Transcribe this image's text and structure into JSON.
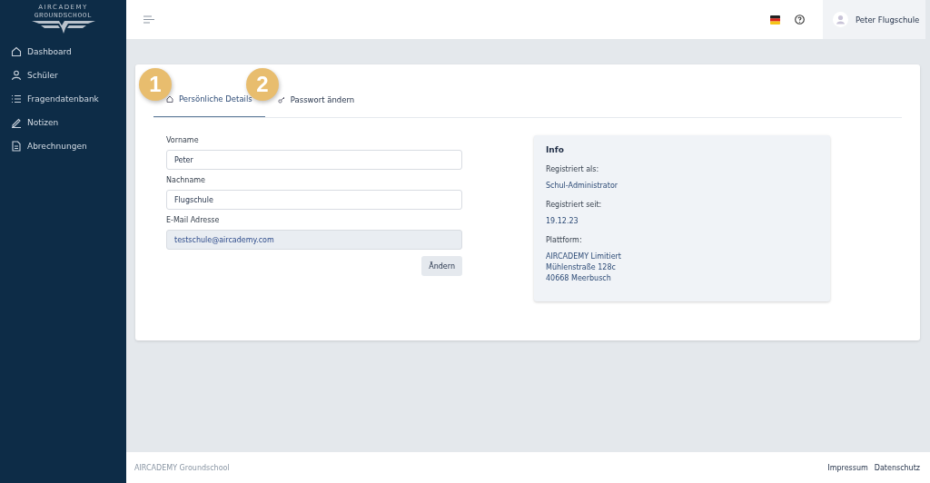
{
  "brand": {
    "line1": "AIRCADEMY",
    "line2": "GROUNDSCHOOL"
  },
  "sidebar": {
    "items": [
      {
        "label": "Dashboard",
        "kind": "home",
        "selected": false
      },
      {
        "label": "Schüler",
        "kind": "user",
        "selected": false
      },
      {
        "label": "Fragendatenbank",
        "kind": "list",
        "selected": false
      },
      {
        "label": "Notizen",
        "kind": "pen",
        "selected": false
      },
      {
        "label": "Abrechnungen",
        "kind": "doc",
        "selected": false
      }
    ]
  },
  "topbar": {
    "user": "Peter Flugschule"
  },
  "markers": [
    "1",
    "2"
  ],
  "tabs": [
    {
      "label": "Persönliche Details",
      "kind": "home",
      "selected": true
    },
    {
      "label": "Passwort ändern",
      "kind": "key",
      "selected": false
    }
  ],
  "form": {
    "fields": [
      {
        "label": "Vorname",
        "value": "Peter",
        "disabled": false
      },
      {
        "label": "Nachname",
        "value": "Flugschule",
        "disabled": false
      },
      {
        "label": "E-Mail Adresse",
        "value": "testschule@aircademy.com",
        "disabled": true
      }
    ],
    "button": "Ändern"
  },
  "info": {
    "title": "Info",
    "entries": [
      {
        "label": "Registriert als:",
        "lines": [
          "Schul-Administrator"
        ]
      },
      {
        "label": "Registriert seit:",
        "lines": [
          "19.12.23"
        ]
      },
      {
        "label": "Plattform:",
        "lines": [
          "AIRCADEMY Limitiert",
          "Mühlenstraße 128c",
          "40668 Meerbusch"
        ]
      }
    ]
  },
  "footer": {
    "brand": "AIRCADEMY Groundschool",
    "links": [
      "Impressum",
      "Datenschutz"
    ]
  }
}
